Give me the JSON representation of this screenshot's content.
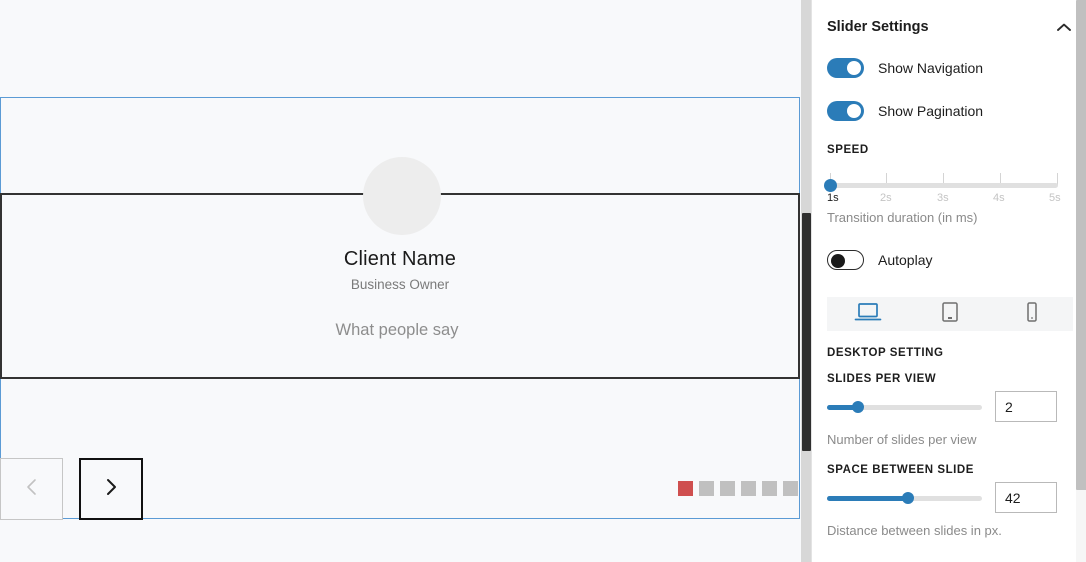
{
  "preview": {
    "slide": {
      "avatar_icon": "avatar-placeholder",
      "client_name": "Client Name",
      "client_role": "Business Owner",
      "quote": "What people say"
    },
    "navigation": {
      "prev_icon": "chevron-left-icon",
      "next_icon": "chevron-right-icon"
    },
    "pagination": {
      "active_index": 0,
      "count": 6,
      "active_color": "#cf4f4f",
      "inactive_color": "#c0c0c0"
    }
  },
  "settings": {
    "panel_title": "Slider Settings",
    "collapse_icon": "chevron-up-icon",
    "toggles": [
      {
        "label": "Show Navigation",
        "state": "on"
      },
      {
        "label": "Show Pagination",
        "state": "on"
      }
    ],
    "speed": {
      "label": "SPEED",
      "ticks": [
        "1s",
        "2s",
        "3s",
        "4s",
        "5s"
      ],
      "active_tick": "1s",
      "value_index": 0,
      "help": "Transition duration (in ms)"
    },
    "autoplay": {
      "label": "Autoplay",
      "state": "off"
    },
    "devices": [
      {
        "name": "desktop",
        "icon": "laptop-icon",
        "active": true
      },
      {
        "name": "tablet",
        "icon": "tablet-icon",
        "active": false
      },
      {
        "name": "mobile",
        "icon": "mobile-icon",
        "active": false
      }
    ],
    "device_section_label": "DESKTOP SETTING",
    "slides_per_view": {
      "label": "SLIDES PER VIEW",
      "value": "2",
      "fill_percent": 20,
      "help": "Number of slides per view"
    },
    "space_between": {
      "label": "SPACE BETWEEN SLIDE",
      "value": "42",
      "fill_percent": 52,
      "help": "Distance between slides in px."
    },
    "accent_color": "#2b7cb8"
  }
}
